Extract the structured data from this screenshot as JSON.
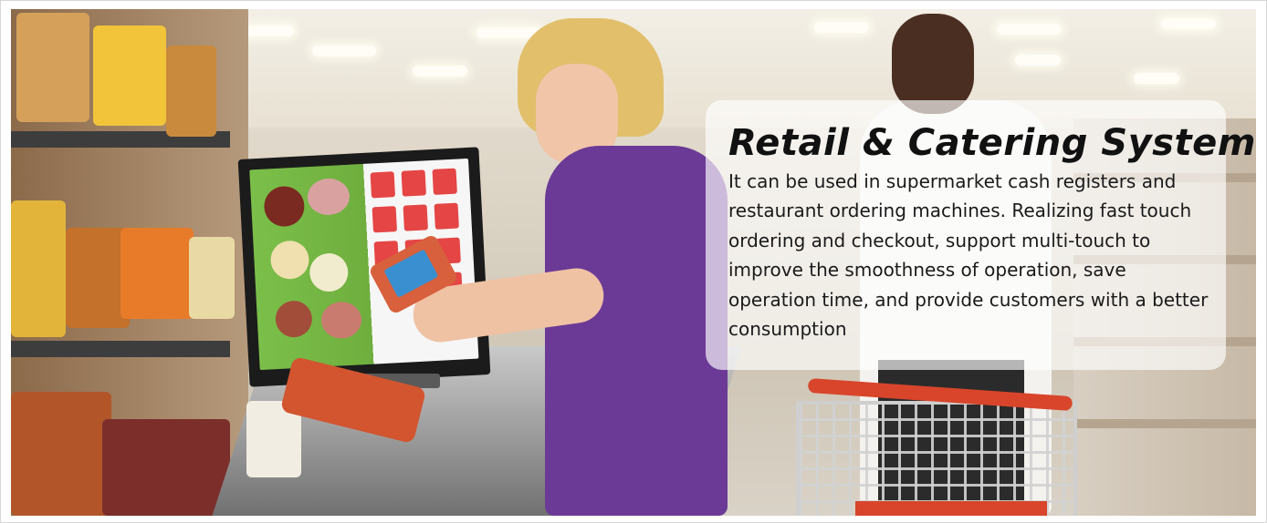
{
  "banner": {
    "title": "Retail & Catering System",
    "description": "It can be used in supermarket cash registers and restaurant ordering machines. Realizing fast touch ordering and checkout, support multi-touch to improve the smoothness of operation, save operation time, and provide customers with a better consumption"
  },
  "photo": {
    "scene": "supermarket-checkout",
    "colors": {
      "uniform": "#6b3a96",
      "cart_handle": "#d8452b",
      "panel_overlay": "rgba(255,255,255,0.66)"
    }
  }
}
